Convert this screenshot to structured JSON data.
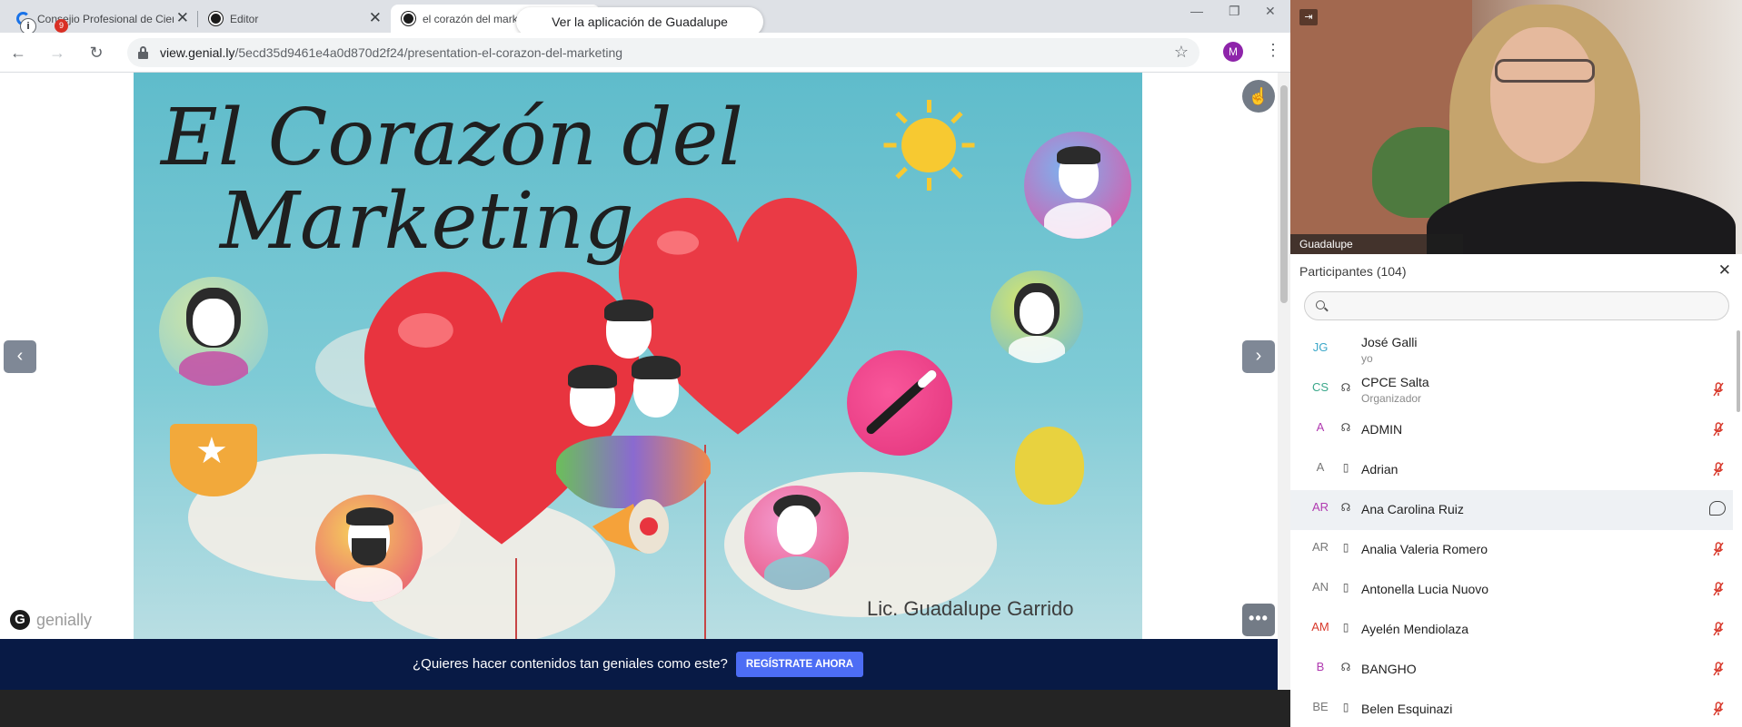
{
  "browser": {
    "tabs": [
      {
        "title": "Consejio Profesional de Ciencias",
        "favicon_color": "#1a73e8",
        "active": false
      },
      {
        "title": "Editor",
        "favicon_color": "#1b1b1b",
        "active": false
      },
      {
        "title": "el corazón del marketing",
        "favicon_color": "#1b1b1b",
        "active": true
      }
    ],
    "notification_count": "9",
    "share_pill": "Ver la aplicación de Guadalupe",
    "url_host": "view.genial.ly",
    "url_path": "/5ecd35d9461e4a0d870d2f24/presentation-el-corazon-del-marketing",
    "profile_initial": "M"
  },
  "slide": {
    "title_line1": "El Corazón del",
    "title_line2": "Marketing",
    "speaker": "Lic. Guadalupe Garrido",
    "brand": "genially",
    "colors": {
      "sky": "#5fbccb",
      "heart": "#e8343f",
      "sun": "#f7c931"
    }
  },
  "cta": {
    "text": "¿Quieres hacer contenidos tan geniales como este?",
    "button": "REGÍSTRATE AHORA"
  },
  "webex": {
    "video_name": "Guadalupe",
    "participants_title": "Participantes (104)",
    "search_placeholder": "",
    "participants": [
      {
        "initials": "JG",
        "name": "José Galli",
        "sub": "yo",
        "device": "",
        "color": "#3aa7c8",
        "status": "none"
      },
      {
        "initials": "CS",
        "name": "CPCE Salta",
        "sub": "Organizador",
        "device": "headset",
        "color": "#3aa78a",
        "status": "muted"
      },
      {
        "initials": "A",
        "name": "ADMIN",
        "sub": "",
        "device": "headset",
        "color": "#b03ab0",
        "status": "muted"
      },
      {
        "initials": "A",
        "name": "Adrian",
        "sub": "",
        "device": "phone",
        "color": "#777777",
        "status": "muted"
      },
      {
        "initials": "AR",
        "name": "Ana Carolina Ruiz",
        "sub": "",
        "device": "headset",
        "color": "#b03ab0",
        "status": "chat",
        "highlight": true
      },
      {
        "initials": "AR",
        "name": "Analia Valeria Romero",
        "sub": "",
        "device": "phone",
        "color": "#777777",
        "status": "muted"
      },
      {
        "initials": "AN",
        "name": "Antonella Lucia Nuovo",
        "sub": "",
        "device": "phone",
        "color": "#777777",
        "status": "muted"
      },
      {
        "initials": "AM",
        "name": "Ayelén Mendiolaza",
        "sub": "",
        "device": "phone",
        "color": "#d8392b",
        "status": "muted"
      },
      {
        "initials": "B",
        "name": "BANGHO",
        "sub": "",
        "device": "headset",
        "color": "#b03ab0",
        "status": "muted"
      },
      {
        "initials": "BE",
        "name": "Belen Esquinazi",
        "sub": "",
        "device": "phone",
        "color": "#777777",
        "status": "muted"
      }
    ]
  }
}
